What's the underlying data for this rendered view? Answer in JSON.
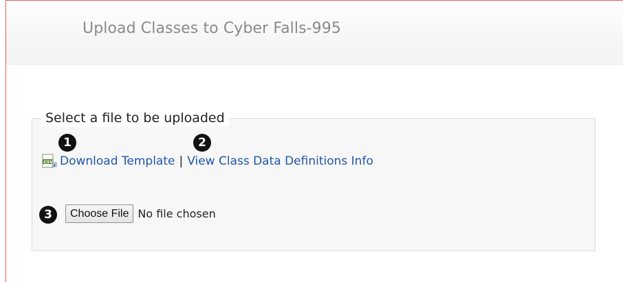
{
  "header": {
    "title": "Upload Classes to Cyber Falls-995"
  },
  "upload_panel": {
    "legend": "Select a file to be uploaded",
    "download_template_label": "Download Template",
    "separator": "|",
    "view_definitions_label": "View Class Data Definitions Info",
    "choose_file_label": "Choose File",
    "file_status": "No file chosen"
  },
  "step_badges": [
    "1",
    "2",
    "3"
  ],
  "icons": {
    "template_icon": "csv-file-icon"
  },
  "colors": {
    "link": "#1f56a6",
    "badge": "#111111",
    "frame_border": "#e8585f"
  }
}
